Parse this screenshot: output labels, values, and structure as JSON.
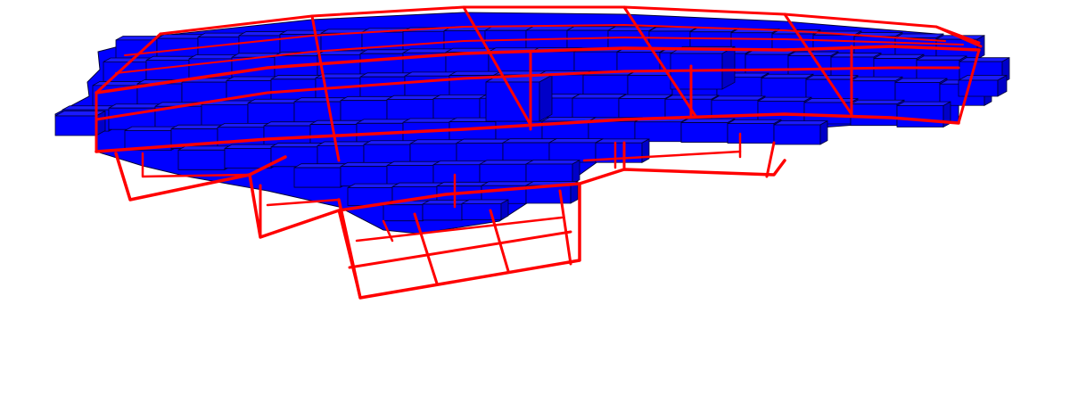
{
  "scene": {
    "background": "#ffffff",
    "voxel_fill": "#0000ff",
    "voxel_side_fill": "#0000c8",
    "voxel_top_fill": "#1a1aff",
    "voxel_edge": "#000033",
    "grid_color": "#ff0000",
    "subject": "voxel-mesh-with-red-bounding-grid"
  }
}
